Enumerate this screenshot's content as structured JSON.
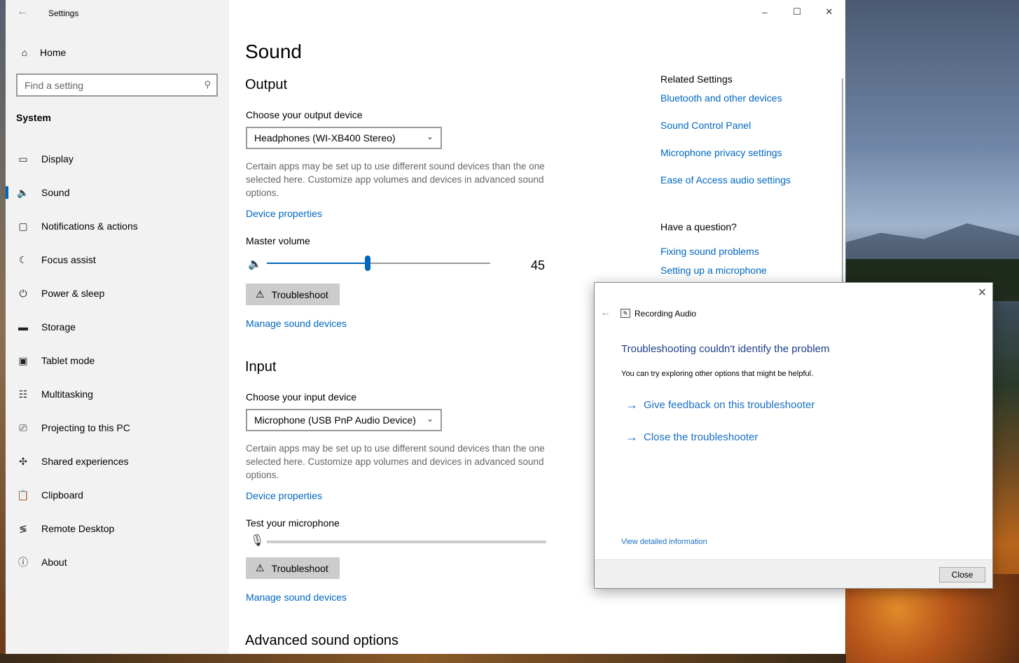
{
  "window": {
    "title": "Settings",
    "controls": [
      "–",
      "☐",
      "✕"
    ]
  },
  "sidebar": {
    "home_label": "Home",
    "search_placeholder": "Find a setting",
    "section_label": "System",
    "items": [
      {
        "label": "Display",
        "icon": "display-icon"
      },
      {
        "label": "Sound",
        "icon": "speaker-icon",
        "active": true
      },
      {
        "label": "Notifications & actions",
        "icon": "notification-icon"
      },
      {
        "label": "Focus assist",
        "icon": "moon-icon"
      },
      {
        "label": "Power & sleep",
        "icon": "power-icon"
      },
      {
        "label": "Storage",
        "icon": "storage-icon"
      },
      {
        "label": "Tablet mode",
        "icon": "tablet-icon"
      },
      {
        "label": "Multitasking",
        "icon": "multitasking-icon"
      },
      {
        "label": "Projecting to this PC",
        "icon": "projector-icon"
      },
      {
        "label": "Shared experiences",
        "icon": "share-icon"
      },
      {
        "label": "Clipboard",
        "icon": "clipboard-icon"
      },
      {
        "label": "Remote Desktop",
        "icon": "remote-icon"
      },
      {
        "label": "About",
        "icon": "info-icon"
      }
    ]
  },
  "main": {
    "page_title": "Sound",
    "output": {
      "heading": "Output",
      "device_label": "Choose your output device",
      "device_value": "Headphones (WI-XB400 Stereo)",
      "description": "Certain apps may be set up to use different sound devices than the one selected here. Customize app volumes and devices in advanced sound options.",
      "properties_link": "Device properties",
      "volume_label": "Master volume",
      "volume_value": "45",
      "volume_fraction": 0.45,
      "troubleshoot_label": "Troubleshoot",
      "manage_link": "Manage sound devices"
    },
    "input": {
      "heading": "Input",
      "device_label": "Choose your input device",
      "device_value": "Microphone (USB PnP Audio Device)",
      "description": "Certain apps may be set up to use different sound devices than the one selected here. Customize app volumes and devices in advanced sound options.",
      "properties_link": "Device properties",
      "test_label": "Test your microphone",
      "troubleshoot_label": "Troubleshoot",
      "manage_link": "Manage sound devices"
    },
    "advanced_heading": "Advanced sound options"
  },
  "related": {
    "title": "Related Settings",
    "links": [
      "Bluetooth and other devices",
      "Sound Control Panel",
      "Microphone privacy settings",
      "Ease of Access audio settings"
    ],
    "question_title": "Have a question?",
    "question_links": [
      "Fixing sound problems",
      "Setting up a microphone"
    ]
  },
  "dialog": {
    "app_name": "Recording Audio",
    "heading": "Troubleshooting couldn't identify the problem",
    "subtext": "You can try exploring other options that might be helpful.",
    "options": [
      "Give feedback on this troubleshooter",
      "Close the troubleshooter"
    ],
    "details_link": "View detailed information",
    "close_button": "Close"
  },
  "colors": {
    "accent": "#0067c0",
    "dialog_heading": "#1e3e8a",
    "dialog_link": "#1a6fc0"
  }
}
